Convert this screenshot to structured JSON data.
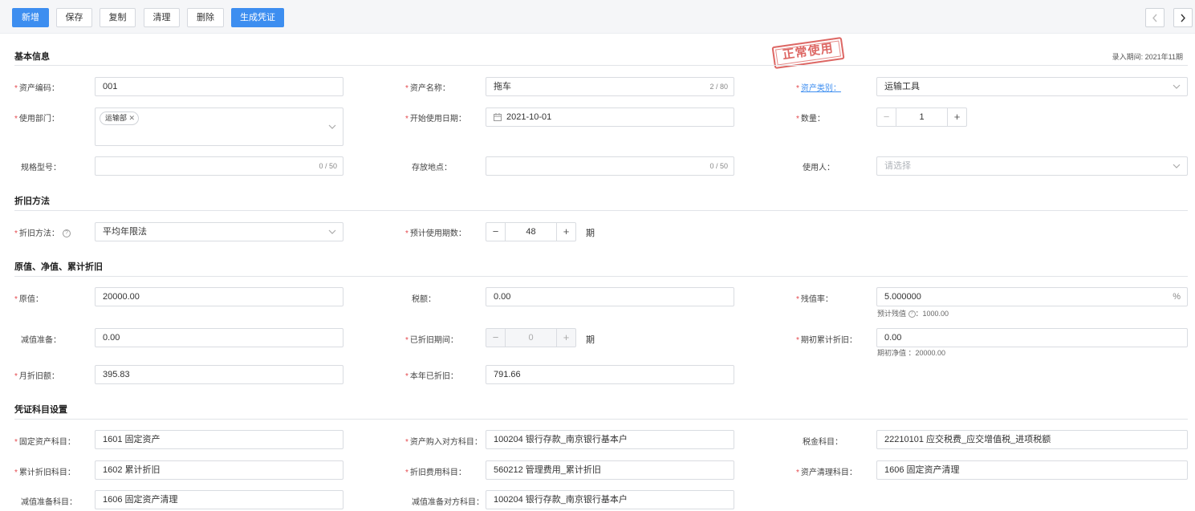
{
  "toolbar": {
    "buttons": [
      "新增",
      "保存",
      "复制",
      "清理",
      "删除",
      "生成凭证"
    ]
  },
  "stamp": "正常使用",
  "period": "录入期间: 2021年11期",
  "sections": {
    "basic": "基本信息",
    "depr": "折旧方法",
    "value": "原值、净值、累计折旧",
    "voucher": "凭证科目设置"
  },
  "basic": {
    "code_label": "资产编码：",
    "code_value": "001",
    "name_label": "资产名称：",
    "name_value": "拖车",
    "name_counter": "2 / 80",
    "category_label": "资产类别：",
    "category_value": "运输工具",
    "dept_label": "使用部门：",
    "dept_tag": "运输部",
    "start_label": "开始使用日期：",
    "start_value": "2021-10-01",
    "qty_label": "数量：",
    "qty_value": "1",
    "spec_label": "规格型号：",
    "spec_counter": "0 / 50",
    "location_label": "存放地点：",
    "location_counter": "0 / 50",
    "user_label": "使用人：",
    "user_placeholder": "请选择"
  },
  "depr": {
    "method_label": "折旧方法：",
    "method_value": "平均年限法",
    "periods_label": "预计使用期数：",
    "periods_value": "48",
    "periods_suffix": "期"
  },
  "value": {
    "original_label": "原值：",
    "original_value": "20000.00",
    "tax_label": "税额：",
    "tax_value": "0.00",
    "residual_label": "残值率：",
    "residual_value": "5.000000",
    "residual_unit": "%",
    "residual_hint_a": "预计残值",
    "residual_hint_b": "：1000.00",
    "impair_label": "减值准备：",
    "impair_value": "0.00",
    "deprp_label": "已折旧期间：",
    "deprp_value": "0",
    "deprp_suffix": "期",
    "initdep_label": "期初累计折旧：",
    "initdep_value": "0.00",
    "initnet_hint": "期初净值 ：20000.00",
    "monthly_label": "月折旧额：",
    "monthly_value": "395.83",
    "yeardep_label": "本年已折旧：",
    "yeardep_value": "791.66"
  },
  "voucher": {
    "fa_label": "固定资产科目：",
    "fa_value": "1601 固定资产",
    "buy_label": "资产购入对方科目：",
    "buy_value": "100204 银行存款_南京银行基本户",
    "taxacc_label": "税金科目：",
    "taxacc_value": "22210101 应交税费_应交增值税_进项税额",
    "accdep_label": "累计折旧科目：",
    "accdep_value": "1602 累计折旧",
    "depexp_label": "折旧费用科目：",
    "depexp_value": "560212 管理费用_累计折旧",
    "clear_label": "资产清理科目：",
    "clear_value": "1606 固定资产清理",
    "impacc_label": "减值准备科目：",
    "impacc_value": "1606 固定资产清理",
    "impcounter_label": "减值准备对方科目：",
    "impcounter_value": "100204 银行存款_南京银行基本户"
  }
}
